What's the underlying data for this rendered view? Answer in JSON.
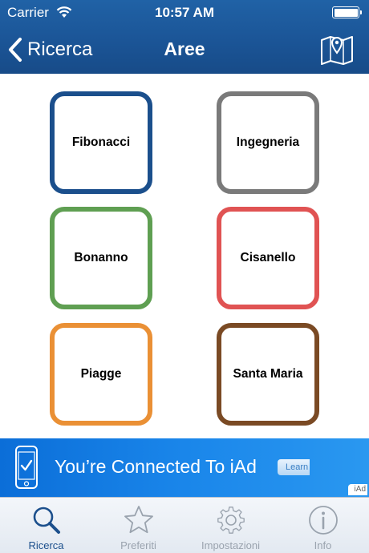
{
  "status_bar": {
    "carrier": "Carrier",
    "time": "10:57 AM"
  },
  "nav": {
    "back_label": "Ricerca",
    "title": "Aree"
  },
  "areas": [
    {
      "name": "Fibonacci",
      "color": "#1b4f8c"
    },
    {
      "name": "Ingegneria",
      "color": "#7a7a7a"
    },
    {
      "name": "Bonanno",
      "color": "#5f9f52"
    },
    {
      "name": "Cisanello",
      "color": "#e05353"
    },
    {
      "name": "Piagge",
      "color": "#ea9035"
    },
    {
      "name": "Santa Maria",
      "color": "#7a4a24"
    }
  ],
  "ad": {
    "text": "You’re Connected To iAd",
    "button": "Learn More",
    "tag": "iAd"
  },
  "tabs": [
    {
      "label": "Ricerca",
      "icon": "magnifier-icon",
      "active": true
    },
    {
      "label": "Preferiti",
      "icon": "star-icon",
      "active": false
    },
    {
      "label": "Impostazioni",
      "icon": "gear-icon",
      "active": false
    },
    {
      "label": "Info",
      "icon": "info-icon",
      "active": false
    }
  ],
  "colors": {
    "nav_blue": "#1b5597",
    "active_tab": "#1b4f8c",
    "inactive_tab": "#9aa3ae"
  }
}
